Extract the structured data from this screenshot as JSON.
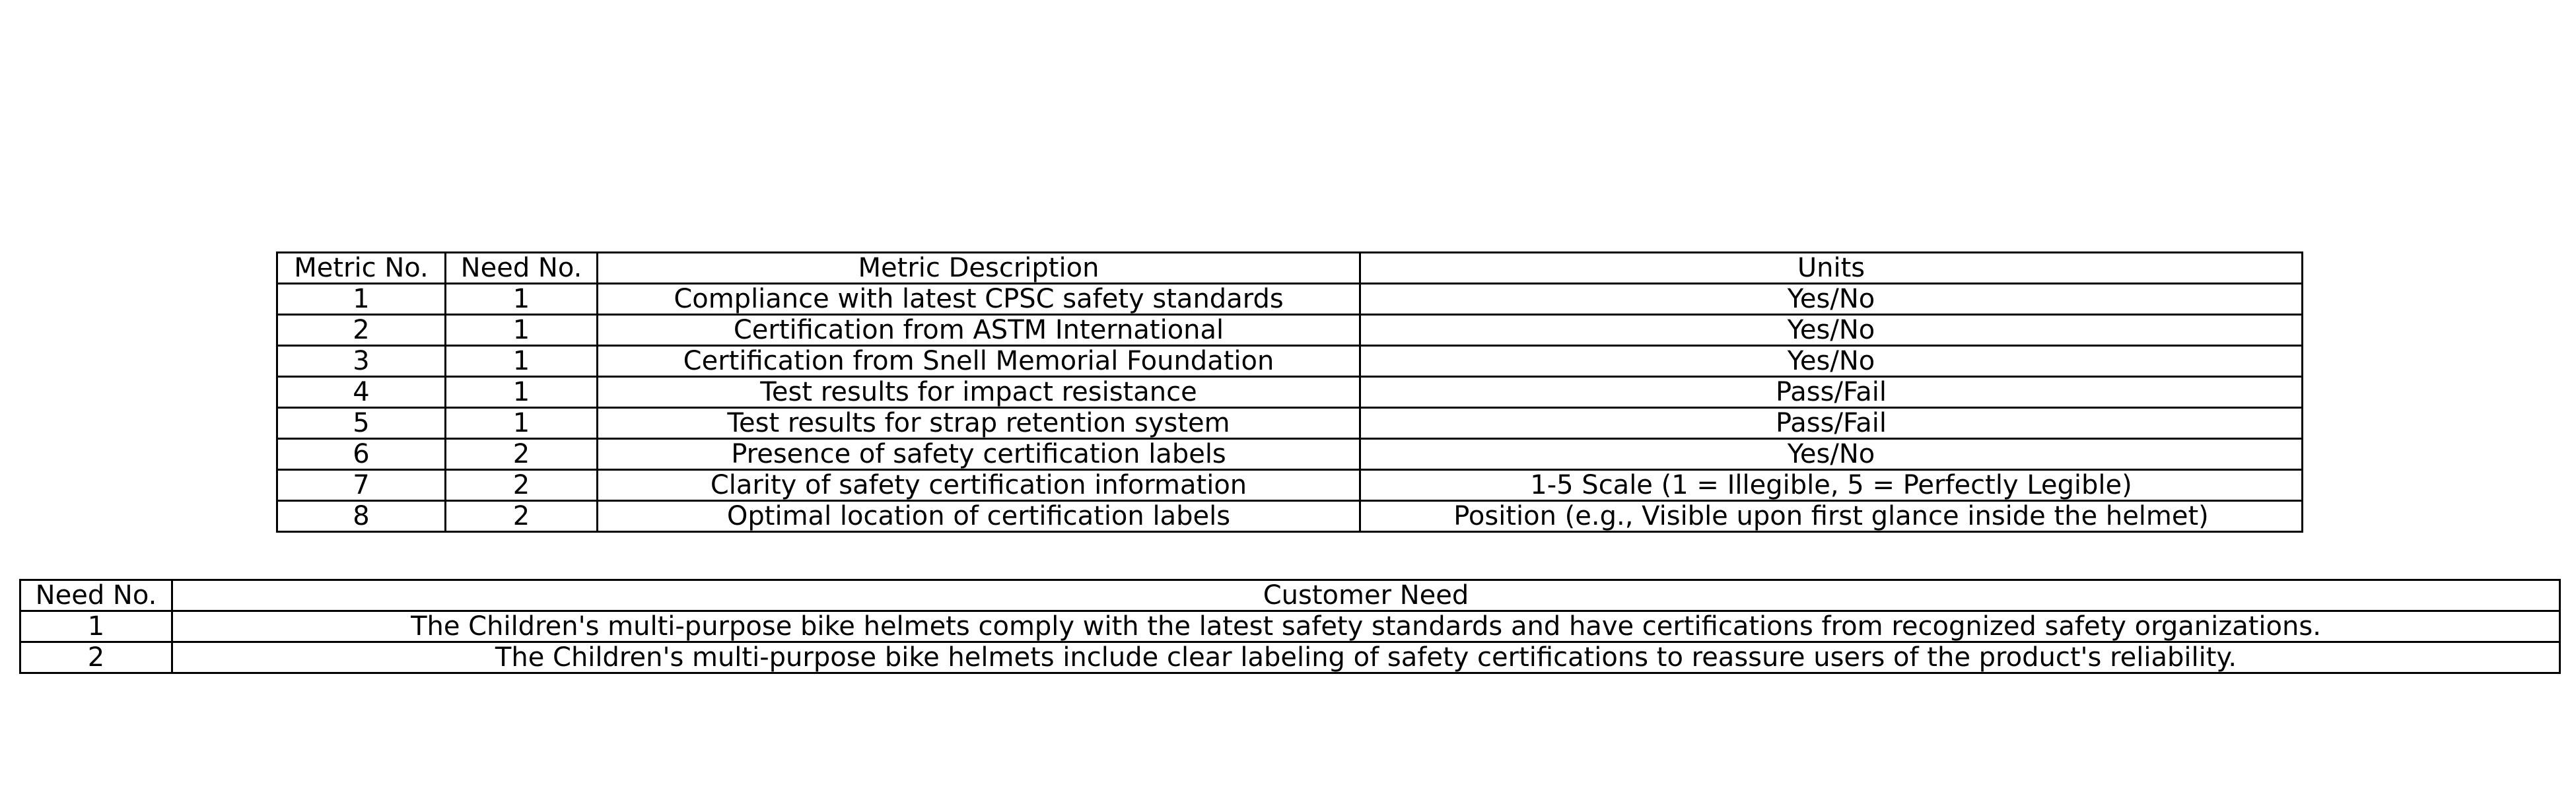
{
  "metrics_table": {
    "headers": [
      "Metric No.",
      "Need No.",
      "Metric Description",
      "Units"
    ],
    "rows": [
      [
        "1",
        "1",
        "Compliance with latest CPSC safety standards",
        "Yes/No"
      ],
      [
        "2",
        "1",
        "Certification from ASTM International",
        "Yes/No"
      ],
      [
        "3",
        "1",
        "Certification from Snell Memorial Foundation",
        "Yes/No"
      ],
      [
        "4",
        "1",
        "Test results for impact resistance",
        "Pass/Fail"
      ],
      [
        "5",
        "1",
        "Test results for strap retention system",
        "Pass/Fail"
      ],
      [
        "6",
        "2",
        "Presence of safety certification labels",
        "Yes/No"
      ],
      [
        "7",
        "2",
        "Clarity of safety certification information",
        "1-5 Scale (1 = Illegible, 5 = Perfectly Legible)"
      ],
      [
        "8",
        "2",
        "Optimal location of certification labels",
        "Position (e.g., Visible upon first glance inside the helmet)"
      ]
    ]
  },
  "needs_table": {
    "headers": [
      "Need No.",
      "Customer Need"
    ],
    "rows": [
      [
        "1",
        "The Children's multi-purpose bike helmets comply with the latest safety standards and have certifications from recognized safety organizations."
      ],
      [
        "2",
        "The Children's multi-purpose bike helmets include clear labeling of safety certifications to reassure users of the product's reliability."
      ]
    ]
  }
}
